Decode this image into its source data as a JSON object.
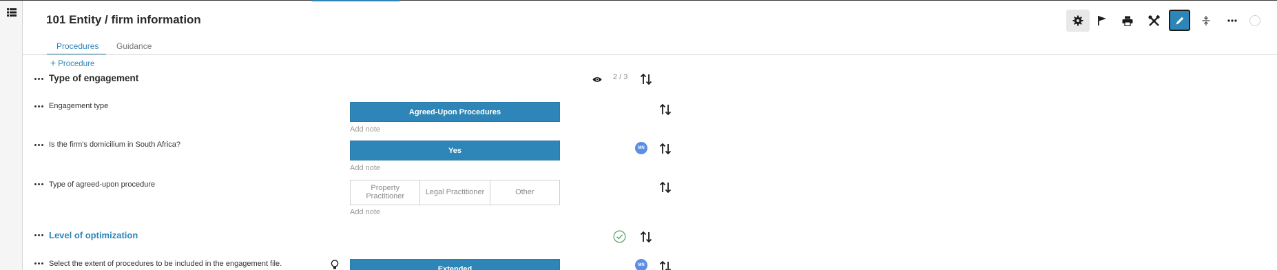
{
  "header": {
    "title": "101 Entity / firm information"
  },
  "toolbar": {
    "buttons": [
      "gear-icon",
      "flag-icon",
      "print-icon",
      "tools-icon",
      "pencil-icon",
      "collapse-icon",
      "more-icon",
      "status-circle"
    ],
    "active_button": "pencil-icon"
  },
  "tabs": [
    {
      "label": "Procedures",
      "active": true
    },
    {
      "label": "Guidance",
      "active": false
    }
  ],
  "add_procedure_label": "Procedure",
  "sections": {
    "engagement": {
      "title": "Type of engagement",
      "counter": "2 / 3",
      "questions": [
        {
          "text": "Engagement type",
          "answer": "Agreed-Upon Procedures",
          "note_placeholder": "Add note"
        },
        {
          "text": "Is the firm's domicilium in South Africa?",
          "answer": "Yes",
          "note_placeholder": "Add note",
          "avatar": "MN"
        },
        {
          "text": "Type of agreed-upon procedure",
          "options": [
            "Property Practitioner",
            "Legal Practitioner",
            "Other"
          ],
          "note_placeholder": "Add note"
        }
      ]
    },
    "optimization": {
      "title": "Level of optimization",
      "questions": [
        {
          "text": "Select the extent of procedures to be included in the engagement file.",
          "answer": "Extended",
          "avatar": "MN"
        }
      ]
    }
  },
  "colors": {
    "accent": "#2e86b8",
    "avatar": "#5b8fe6",
    "check": "#5aa86b"
  }
}
